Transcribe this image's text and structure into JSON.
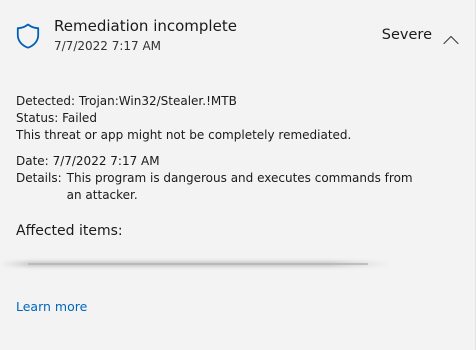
{
  "header": {
    "icon": "shield-icon",
    "title": "Remediation incomplete",
    "timestamp": "7/7/2022 7:17 AM",
    "severity": "Severe",
    "toggle_icon": "chevron-up-icon"
  },
  "details": {
    "detected_label": "Detected:",
    "detected_value": "Trojan:Win32/Stealer.!MTB",
    "status_label": "Status:",
    "status_value": "Failed",
    "status_message": "This threat or app might not be completely remediated.",
    "date_label": "Date:",
    "date_value": "7/7/2022 7:17 AM",
    "details_label": "Details:",
    "details_value": "This program is dangerous and executes commands from an attacker."
  },
  "affected_items": {
    "heading": "Affected items:"
  },
  "links": {
    "learn_more": "Learn more"
  },
  "colors": {
    "accent": "#0067c0",
    "shield": "#005fb8",
    "background": "#f3f3f3"
  }
}
